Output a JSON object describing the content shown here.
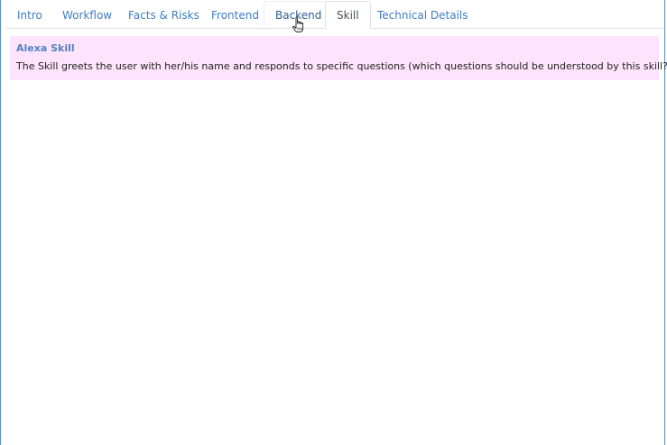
{
  "tabs": [
    {
      "label": "Intro",
      "state": "normal"
    },
    {
      "label": "Workflow",
      "state": "normal"
    },
    {
      "label": "Facts & Risks",
      "state": "normal"
    },
    {
      "label": "Frontend",
      "state": "normal"
    },
    {
      "label": "Backend",
      "state": "hover"
    },
    {
      "label": "Skill",
      "state": "active"
    },
    {
      "label": "Technical Details",
      "state": "normal"
    }
  ],
  "skill_panel": {
    "title": "Alexa Skill",
    "description": "The Skill greets the user with her/his name and responds to specific questions (which questions should be understood by this skill?)"
  },
  "colors": {
    "tab_link": "#3f7ec0",
    "tab_active_text": "#495057",
    "callout_background": "#fde3fb",
    "callout_title": "#4f83c3",
    "frame_border": "#5b8fc7"
  },
  "icons": {
    "cursor": "hand-pointer-icon"
  }
}
